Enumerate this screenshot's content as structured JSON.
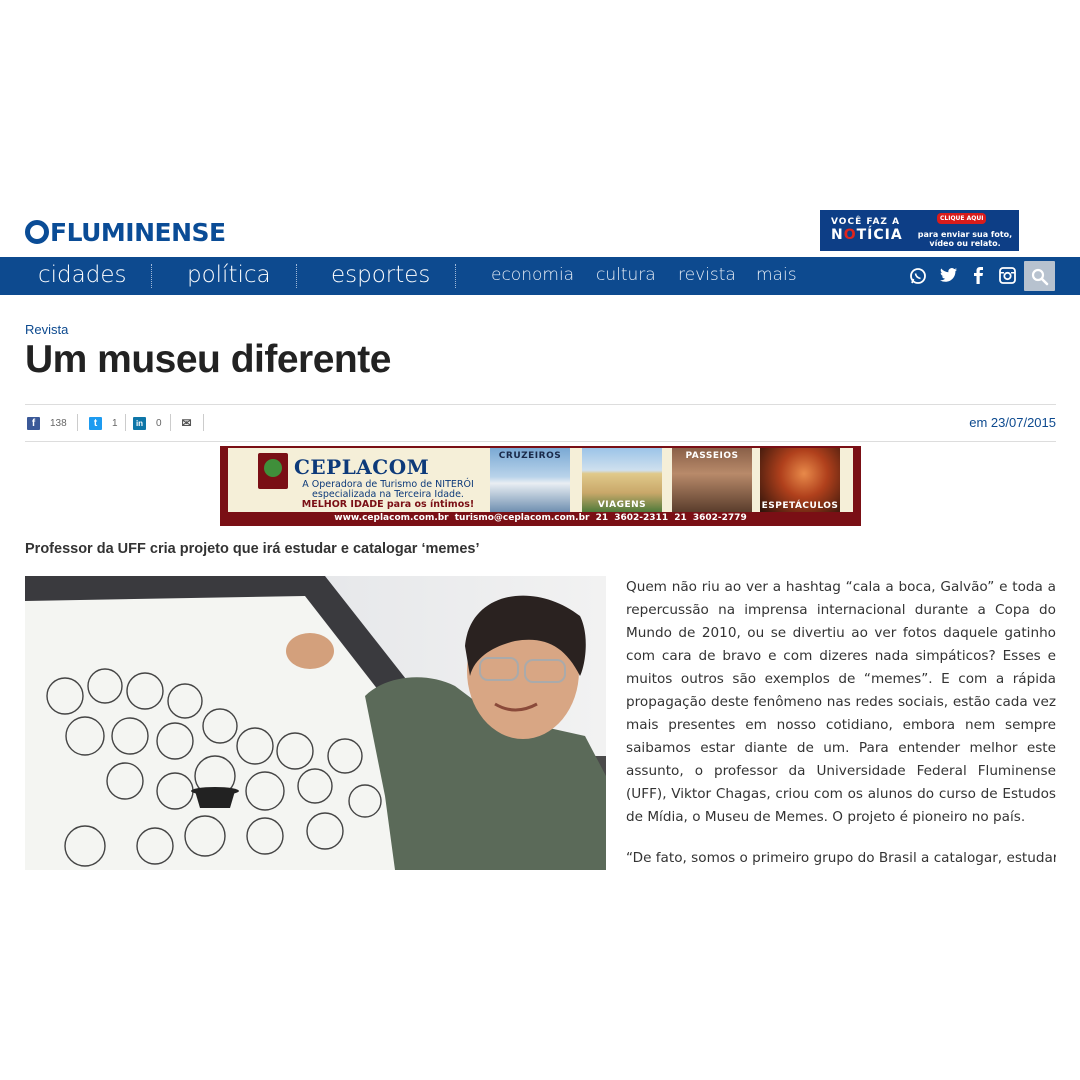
{
  "header": {
    "logo_prefix": "O",
    "logo_text": "FLUMINENSE",
    "promo": {
      "line1": "VOCÊ FAZ A",
      "line2_pre": "N",
      "line2_red": "O",
      "line2_post": "TÍCIA",
      "cta": "CLIQUE AQUI",
      "right_line1": "para enviar sua foto,",
      "right_line2": "vídeo ou relato."
    }
  },
  "nav": {
    "primary": [
      "cidades",
      "política",
      "esportes"
    ],
    "secondary": [
      "economia",
      "cultura",
      "revista",
      "mais"
    ],
    "social_icons": [
      "whatsapp-icon",
      "twitter-icon",
      "facebook-icon",
      "instagram-icon"
    ],
    "search_icon": "search-icon",
    "colors": {
      "bar": "#0d4a8f",
      "search": "#b7c2cf"
    }
  },
  "article": {
    "section": "Revista",
    "title": "Um museu diferente",
    "shares": [
      {
        "network": "facebook",
        "icon": "f",
        "count": "138"
      },
      {
        "network": "twitter",
        "icon": "t",
        "count": "1"
      },
      {
        "network": "linkedin",
        "icon": "in",
        "count": "0"
      },
      {
        "network": "email",
        "icon": "✉",
        "count": ""
      }
    ],
    "date": "em 23/07/2015",
    "lead": "Professor da UFF cria projeto que irá estudar e catalogar ‘memes’",
    "paragraphs": [
      "Quem não riu ao ver a hashtag “cala a boca, Galvão” e toda a repercussão na imprensa internacional durante a Copa do Mundo de 2010, ou se divertiu ao ver fotos daquele gatinho com cara de bravo e com dizeres nada simpáticos? Esses e muitos outros são exemplos de “memes”. E com a rápida propagação deste fenômeno nas redes sociais, estão cada vez mais presentes em nosso cotidiano, embora nem sempre saibamos estar diante de um. Para entender melhor este assunto, o professor da Universidade Federal Fluminense (UFF), Viktor Chagas, criou com os alunos do curso de Estudos de Mídia, o Museu de Memes. O projeto é pioneiro no país.",
      "“De fato, somos o primeiro grupo do Brasil a catalogar, estudar e"
    ]
  },
  "ad": {
    "brand": "CEPLACOM",
    "line1": "A Operadora de Turismo de NITERÓI",
    "line2": "especializada na Terceira Idade.",
    "line3": "MELHOR IDADE para os íntimos!",
    "photos": [
      "CRUZEIROS",
      "VIAGENS",
      "PASSEIOS",
      "ESPETÁCULOS"
    ],
    "footer": "www.ceplacom.com.br   turismo@ceplacom.com.br   21 3602-2311   21 3602-2779"
  }
}
